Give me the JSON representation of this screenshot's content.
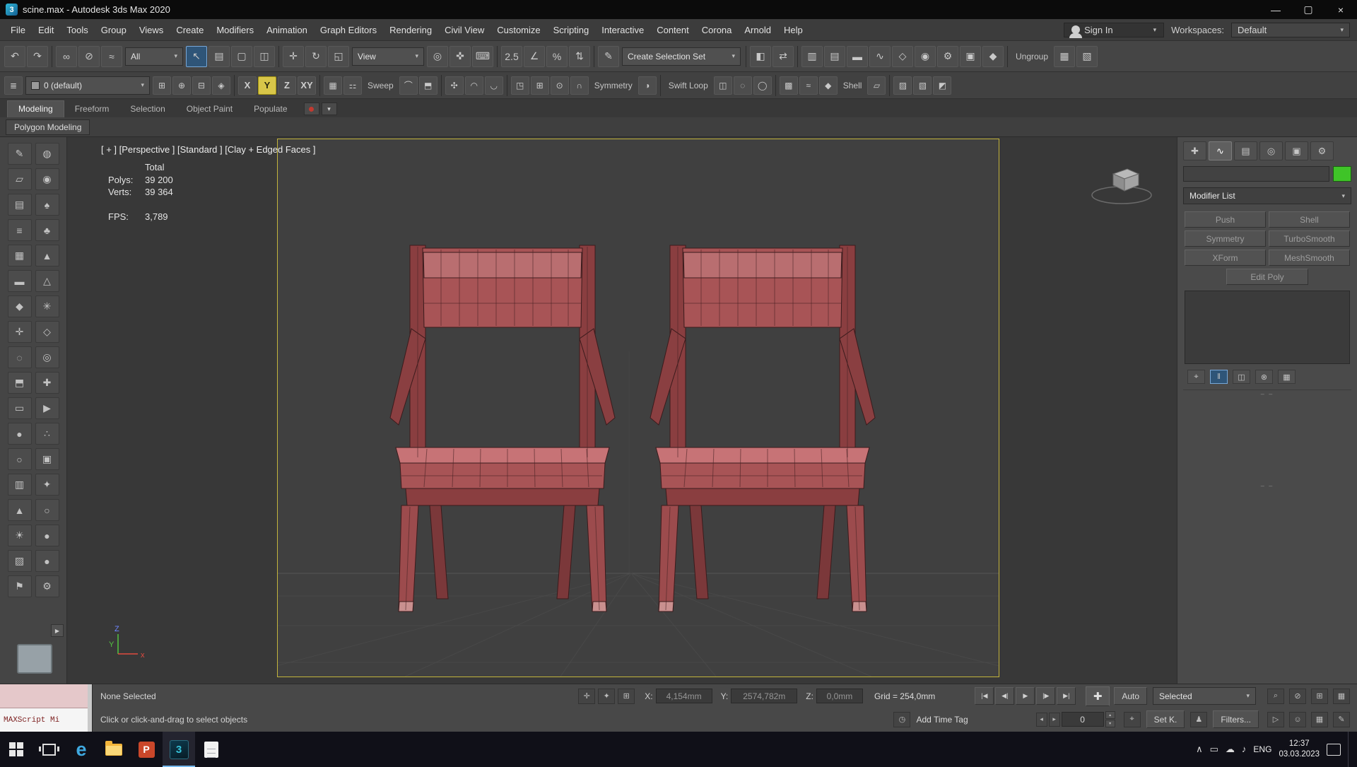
{
  "window": {
    "title": "scine.max - Autodesk 3ds Max 2020",
    "app_icon_letter": "3",
    "controls": [
      {
        "n": "minimize-button",
        "g": "—"
      },
      {
        "n": "maximize-button",
        "g": "▢"
      },
      {
        "n": "close-button",
        "g": "×"
      }
    ]
  },
  "menu": {
    "items": [
      "File",
      "Edit",
      "Tools",
      "Group",
      "Views",
      "Create",
      "Modifiers",
      "Animation",
      "Graph Editors",
      "Rendering",
      "Civil View",
      "Customize",
      "Scripting",
      "Interactive",
      "Content",
      "Corona",
      "Arnold",
      "Help"
    ],
    "sign_in": "Sign In",
    "workspaces_label": "Workspaces:",
    "workspace_value": "Default"
  },
  "toolbar_main": {
    "items": [
      {
        "k": "i",
        "n": "undo-icon",
        "g": "↶"
      },
      {
        "k": "i",
        "n": "redo-icon",
        "g": "↷"
      },
      {
        "k": "s"
      },
      {
        "k": "i",
        "n": "select-and-link-icon",
        "g": "∞"
      },
      {
        "k": "i",
        "n": "unlink-selection-icon",
        "g": "⊘"
      },
      {
        "k": "i",
        "n": "bind-to-space-warp-icon",
        "g": "≈"
      },
      {
        "k": "d",
        "n": "selection-filter-dropdown",
        "label": "All"
      },
      {
        "k": "i",
        "n": "select-object-icon",
        "g": "↖",
        "hl": 1
      },
      {
        "k": "i",
        "n": "select-by-name-icon",
        "g": "▤"
      },
      {
        "k": "i",
        "n": "rectangular-selection-region-icon",
        "g": "▢"
      },
      {
        "k": "i",
        "n": "window-crossing-toggle-icon",
        "g": "◫"
      },
      {
        "k": "s"
      },
      {
        "k": "i",
        "n": "select-and-move-icon",
        "g": "✛"
      },
      {
        "k": "i",
        "n": "select-and-rotate-icon",
        "g": "↻"
      },
      {
        "k": "i",
        "n": "select-and-scale-icon",
        "g": "◱"
      },
      {
        "k": "d",
        "n": "reference-coordinate-system-dropdown",
        "label": "View"
      },
      {
        "k": "i",
        "n": "use-pivot-point-center-icon",
        "g": "◎"
      },
      {
        "k": "i",
        "n": "select-and-manipulate-icon",
        "g": "✜"
      },
      {
        "k": "i",
        "n": "keyboard-shortcut-override-icon",
        "g": "⌨"
      },
      {
        "k": "s"
      },
      {
        "k": "t",
        "n": "snaps-toggle-icon",
        "label": "2.5"
      },
      {
        "k": "i",
        "n": "angle-snap-toggle-icon",
        "g": "∠"
      },
      {
        "k": "i",
        "n": "percent-snap-toggle-icon",
        "g": "%"
      },
      {
        "k": "i",
        "n": "spinner-snap-toggle-icon",
        "g": "⇅"
      },
      {
        "k": "s"
      },
      {
        "k": "i",
        "n": "edit-named-selection-sets-icon",
        "g": "✎"
      },
      {
        "k": "d",
        "n": "create-selection-set-dropdown",
        "label": "Create Selection Set"
      },
      {
        "k": "s"
      },
      {
        "k": "i",
        "n": "mirror-icon",
        "g": "◧"
      },
      {
        "k": "i",
        "n": "align-icon",
        "g": "⇄"
      },
      {
        "k": "s"
      },
      {
        "k": "i",
        "n": "scene-explorer-icon",
        "g": "▥"
      },
      {
        "k": "i",
        "n": "layer-explorer-icon",
        "g": "▤"
      },
      {
        "k": "i",
        "n": "ribbon-toggle-icon",
        "g": "▬"
      },
      {
        "k": "i",
        "n": "curve-editor-icon",
        "g": "∿"
      },
      {
        "k": "i",
        "n": "schematic-view-icon",
        "g": "◇"
      },
      {
        "k": "i",
        "n": "material-editor-icon",
        "g": "◉"
      },
      {
        "k": "i",
        "n": "render-setup-icon",
        "g": "⚙"
      },
      {
        "k": "i",
        "n": "rendered-frame-window-icon",
        "g": "▣"
      },
      {
        "k": "i",
        "n": "render-production-icon",
        "g": "◆"
      },
      {
        "k": "s"
      },
      {
        "k": "l",
        "n": "ungroup-label",
        "label": "Ungroup"
      },
      {
        "k": "i",
        "n": "extra-tool-icon",
        "g": "▦"
      },
      {
        "k": "i",
        "n": "extra-tool-2-icon",
        "g": "▧"
      }
    ]
  },
  "toolbar_secondary": {
    "items": [
      {
        "k": "i",
        "n": "layer-manager-icon",
        "g": "≣"
      },
      {
        "k": "d",
        "n": "active-layer-dropdown",
        "label": "0 (default)",
        "chip": true
      },
      {
        "k": "i",
        "n": "create-new-layer-icon",
        "g": "⊞"
      },
      {
        "k": "i",
        "n": "add-to-layer-icon",
        "g": "⊕"
      },
      {
        "k": "i",
        "n": "select-layer-objects-icon",
        "g": "⊟"
      },
      {
        "k": "i",
        "n": "set-current-layer-icon",
        "g": "◈"
      },
      {
        "k": "s"
      },
      {
        "k": "c",
        "n": "restrict-x-icon",
        "label": "X"
      },
      {
        "k": "c",
        "n": "restrict-y-icon",
        "label": "Y",
        "hl": 2
      },
      {
        "k": "c",
        "n": "restrict-z-icon",
        "label": "Z"
      },
      {
        "k": "c",
        "n": "restrict-xy-plane-icon",
        "label": "XY"
      },
      {
        "k": "s"
      },
      {
        "k": "i",
        "n": "snap-grid-icon",
        "g": "▦"
      },
      {
        "k": "i",
        "n": "snap-settings-icon",
        "g": "⚏"
      },
      {
        "k": "l",
        "n": "sweep-label",
        "label": "Sweep"
      },
      {
        "k": "i",
        "n": "sweep-icon",
        "g": "⌒"
      },
      {
        "k": "i",
        "n": "extrude-icon",
        "g": "⬒"
      },
      {
        "k": "s"
      },
      {
        "k": "i",
        "n": "paint-deform-icon",
        "g": "✣"
      },
      {
        "k": "i",
        "n": "relax-icon",
        "g": "◠"
      },
      {
        "k": "i",
        "n": "conform-icon",
        "g": "◡"
      },
      {
        "k": "s"
      },
      {
        "k": "i",
        "n": "detach-icon",
        "g": "◳"
      },
      {
        "k": "i",
        "n": "attach-icon",
        "g": "⊞"
      },
      {
        "k": "i",
        "n": "weld-icon",
        "g": "⊙"
      },
      {
        "k": "i",
        "n": "bridge-icon",
        "g": "∩"
      },
      {
        "k": "l",
        "n": "symmetry-label",
        "label": "Symmetry"
      },
      {
        "k": "i",
        "n": "symmetry-icon",
        "g": "◑"
      },
      {
        "k": "s"
      },
      {
        "k": "l",
        "n": "swift-loop-label",
        "label": "Swift Loop"
      },
      {
        "k": "i",
        "n": "swift-loop-icon",
        "g": "◫"
      },
      {
        "k": "i",
        "n": "ring-select-icon",
        "g": "◌"
      },
      {
        "k": "i",
        "n": "loop-select-icon",
        "g": "◯"
      },
      {
        "k": "s"
      },
      {
        "k": "i",
        "n": "quadrify-icon",
        "g": "▩"
      },
      {
        "k": "i",
        "n": "smooth-icon",
        "g": "≈"
      },
      {
        "k": "i",
        "n": "bevel-icon",
        "g": "◆"
      },
      {
        "k": "l",
        "n": "shell-label",
        "label": "Shell"
      },
      {
        "k": "i",
        "n": "shell-icon",
        "g": "▱"
      },
      {
        "k": "s"
      },
      {
        "k": "i",
        "n": "misc-tool-icon",
        "g": "▨"
      },
      {
        "k": "i",
        "n": "misc-tool-2-icon",
        "g": "▧"
      },
      {
        "k": "i",
        "n": "misc-tool-3-icon",
        "g": "◩"
      }
    ]
  },
  "ribbon": {
    "tabs": [
      {
        "label": "Modeling",
        "active": true
      },
      {
        "label": "Freeform",
        "active": false
      },
      {
        "label": "Selection",
        "active": false
      },
      {
        "label": "Object Paint",
        "active": false
      },
      {
        "label": "Populate",
        "active": false
      }
    ],
    "panel_label": "Polygon Modeling"
  },
  "left_toolbar": {
    "icons": [
      {
        "n": "paint-tool-icon",
        "g": "✎"
      },
      {
        "n": "snap-magnet-icon",
        "g": "◍"
      },
      {
        "n": "plane-primitive-icon",
        "g": "▱"
      },
      {
        "n": "sphere-primitive-icon",
        "g": "◉"
      },
      {
        "n": "sheet-icon",
        "g": "▤"
      },
      {
        "n": "tree-icon",
        "g": "♠"
      },
      {
        "n": "list-icon",
        "g": "≡"
      },
      {
        "n": "foliage-icon",
        "g": "♣"
      },
      {
        "n": "grid-helper-icon",
        "g": "▦"
      },
      {
        "n": "mountain-icon",
        "g": "▲"
      },
      {
        "n": "slab-icon",
        "g": "▬"
      },
      {
        "n": "pyramid-primitive-icon",
        "g": "△"
      },
      {
        "n": "gold-bar-icon",
        "g": "◆"
      },
      {
        "n": "spray-icon",
        "g": "✳"
      },
      {
        "n": "move-gizmo-icon",
        "g": "✛"
      },
      {
        "n": "polygon-icon",
        "g": "◇"
      },
      {
        "n": "ring-icon",
        "g": "◌"
      },
      {
        "n": "wire-sphere-icon",
        "g": "◎"
      },
      {
        "n": "box-primitive-icon",
        "g": "⬒"
      },
      {
        "n": "cross-icon",
        "g": "✚"
      },
      {
        "n": "rectangle-icon",
        "g": "▭"
      },
      {
        "n": "play-shape-icon",
        "g": "▶"
      },
      {
        "n": "solid-sphere-icon",
        "g": "●"
      },
      {
        "n": "scatter-icon",
        "g": "∴"
      },
      {
        "n": "circle-shape-icon",
        "g": "○"
      },
      {
        "n": "cube-icon",
        "g": "▣"
      },
      {
        "n": "basket-icon",
        "g": "▥"
      },
      {
        "n": "gem-icon",
        "g": "✦"
      },
      {
        "n": "cone-primitive-icon",
        "g": "▲"
      },
      {
        "n": "bulb-icon",
        "g": "○"
      },
      {
        "n": "sun-icon",
        "g": "☀"
      },
      {
        "n": "dark-sphere-icon",
        "g": "●"
      },
      {
        "n": "pattern-icon",
        "g": "▨"
      },
      {
        "n": "cherry-icon",
        "g": "●"
      },
      {
        "n": "flag-icon",
        "g": "⚑"
      },
      {
        "n": "gear-icon",
        "g": "⚙"
      }
    ]
  },
  "viewport": {
    "label": "[ + ] [Perspective ] [Standard ] [Clay + Edged Faces ]",
    "stats": {
      "header": "Total",
      "polys_label": "Polys:",
      "polys_value": "39 200",
      "verts_label": "Verts:",
      "verts_value": "39 364",
      "fps_label": "FPS:",
      "fps_value": "3,789"
    },
    "axis_labels": {
      "x": "x",
      "y": "Y",
      "z": "Z"
    }
  },
  "command_panel": {
    "tabs": [
      {
        "n": "create-tab-icon",
        "g": "✚",
        "active": false
      },
      {
        "n": "modify-tab-icon",
        "g": "∿",
        "active": true
      },
      {
        "n": "hierarchy-tab-icon",
        "g": "▤",
        "active": false
      },
      {
        "n": "motion-tab-icon",
        "g": "◎",
        "active": false
      },
      {
        "n": "display-tab-icon",
        "g": "▣",
        "active": false
      },
      {
        "n": "utilities-tab-icon",
        "g": "⚙",
        "active": false
      }
    ],
    "object_name_value": "",
    "modifier_list_label": "Modifier List",
    "modifier_buttons": [
      "Push",
      "Shell",
      "Symmetry",
      "TurboSmooth",
      "XForm",
      "MeshSmooth",
      "Edit Poly"
    ],
    "stack_icons": [
      {
        "n": "pin-stack-icon",
        "g": "⌖",
        "hl": false
      },
      {
        "n": "show-end-result-icon",
        "g": "‖",
        "hl": true
      },
      {
        "n": "make-unique-icon",
        "g": "◫",
        "hl": false
      },
      {
        "n": "remove-modifier-icon",
        "g": "⊗",
        "hl": false
      },
      {
        "n": "configure-modifier-sets-icon",
        "g": "▦",
        "hl": false
      }
    ],
    "grip_glyph": "‒ ‒"
  },
  "status": {
    "maxscript_text": "MAXScript Mi",
    "selection": "None Selected",
    "prompt": "Click or click-and-drag to select objects",
    "pre_coord_icons": [
      {
        "n": "transform-gizmo-toggle-icon",
        "g": "✛"
      },
      {
        "n": "selection-lock-toggle-icon",
        "g": "✦"
      },
      {
        "n": "absolute-offset-toggle-icon",
        "g": "⊞"
      }
    ],
    "x_label": "X:",
    "x_value": "4,154mm",
    "y_label": "Y:",
    "y_value": "2574,782m",
    "z_label": "Z:",
    "z_value": "0,0mm",
    "grid_text": "Grid = 254,0mm",
    "time_buttons": [
      {
        "n": "go-to-start-button",
        "g": "|◀"
      },
      {
        "n": "previous-frame-button",
        "g": "◀|"
      },
      {
        "n": "play-animation-button",
        "g": "▶"
      },
      {
        "n": "next-frame-button",
        "g": "|▶"
      },
      {
        "n": "go-to-end-button",
        "g": "▶|"
      }
    ],
    "set_keys_glyph": "✚",
    "auto_label": "Auto",
    "selected_label": "Selected",
    "right_icons_row1": [
      {
        "n": "search-icon",
        "g": "⌕"
      },
      {
        "n": "isolate-selection-icon",
        "g": "⊘"
      },
      {
        "n": "zoom-extents-icon",
        "g": "⊞"
      },
      {
        "n": "viewport-layout-icon",
        "g": "▦"
      }
    ],
    "add_time_tag": "Add Time Tag",
    "time_tag_icon_glyph": "◷",
    "frame_value": "0",
    "key_mode_icon_glyph": "⌖",
    "set_key_label": "Set K.",
    "walkthrough_icon_glyph": "♟",
    "filters_label": "Filters...",
    "right_icons_row2": [
      {
        "n": "mini-play-icon",
        "g": "▷"
      },
      {
        "n": "avatar-icon",
        "g": "☺"
      },
      {
        "n": "grid-small-icon",
        "g": "▦"
      },
      {
        "n": "edit-pencil-icon",
        "g": "✎"
      }
    ]
  },
  "taskbar": {
    "apps": [
      {
        "n": "start-button",
        "kind": "start",
        "active": false
      },
      {
        "n": "task-view-button",
        "kind": "taskview",
        "active": false
      },
      {
        "n": "edge-app-icon",
        "kind": "edge",
        "letter": "e",
        "active": false
      },
      {
        "n": "file-explorer-app-icon",
        "kind": "explorer",
        "active": false
      },
      {
        "n": "powerpoint-app-icon",
        "kind": "ppt",
        "letter": "P",
        "active": false
      },
      {
        "n": "3dsmax-app-icon",
        "kind": "max",
        "letter": "3",
        "active": true
      },
      {
        "n": "secondary-app-icon",
        "kind": "doc",
        "active": false
      }
    ],
    "tray_icons": [
      {
        "n": "hidden-icons-expand-icon",
        "g": "∧"
      },
      {
        "n": "pc-status-icon",
        "g": "▭"
      },
      {
        "n": "cloud-icon",
        "g": "☁"
      },
      {
        "n": "volume-icon",
        "g": "♪"
      }
    ],
    "language": "ENG",
    "time": "12:37",
    "date": "03.03.2023"
  },
  "colors": {
    "accent_yellow": "#c3b43c",
    "selection_blue": "#2f5578",
    "taskbar_bg": "#101018",
    "swatch_green": "#3fc428",
    "viewport_bg": "#404040",
    "viewport_outer": "#383838",
    "chair_top": "#c77376",
    "chair_mid": "#a85456",
    "chair_band": "#b96e70",
    "chair_dark": "#8a3e40",
    "chair_rail": "#8a3f41",
    "chair_deep": "#7b383a",
    "chair_leg": "#9c4b4d",
    "chair_foot": "#c9908f",
    "chair_edge": "#3a1b1c",
    "axis_x_red": "#e04a3f",
    "axis_y_green": "#53c441",
    "axis_z_blue": "#6f86ff"
  }
}
